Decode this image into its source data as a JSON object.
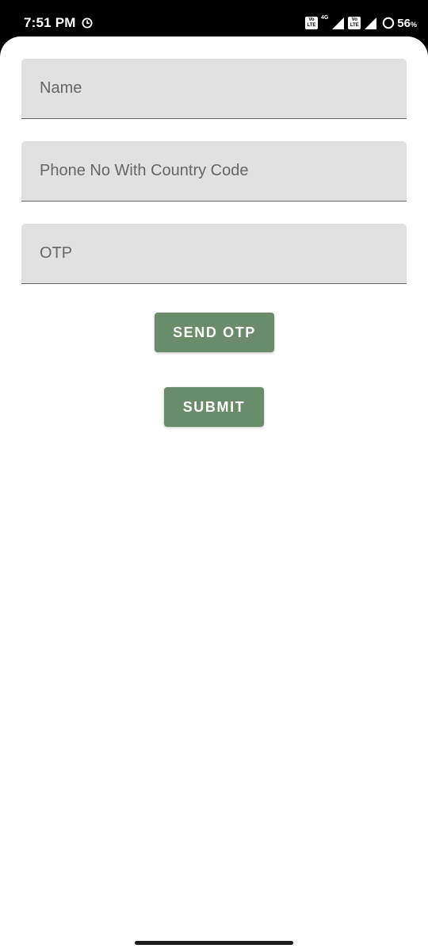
{
  "status_bar": {
    "time": "7:51 PM",
    "volte_label": "Vo LTE",
    "network_type": "4G",
    "battery_percent": "56",
    "battery_unit": "%",
    "icons": [
      "alarm-icon",
      "volte-icon",
      "signal-icon",
      "volte-icon",
      "signal-icon",
      "battery-ring-icon"
    ]
  },
  "form": {
    "name_placeholder": "Name",
    "name_value": "",
    "phone_placeholder": "Phone No With Country Code",
    "phone_value": "",
    "otp_placeholder": "OTP",
    "otp_value": "",
    "send_otp_label": "SEND OTP",
    "submit_label": "SUBMIT"
  },
  "colors": {
    "button": "#6b8c6b",
    "field_background": "#e1e1e1",
    "field_underline": "#6b6b6b",
    "placeholder_text": "#666666"
  }
}
